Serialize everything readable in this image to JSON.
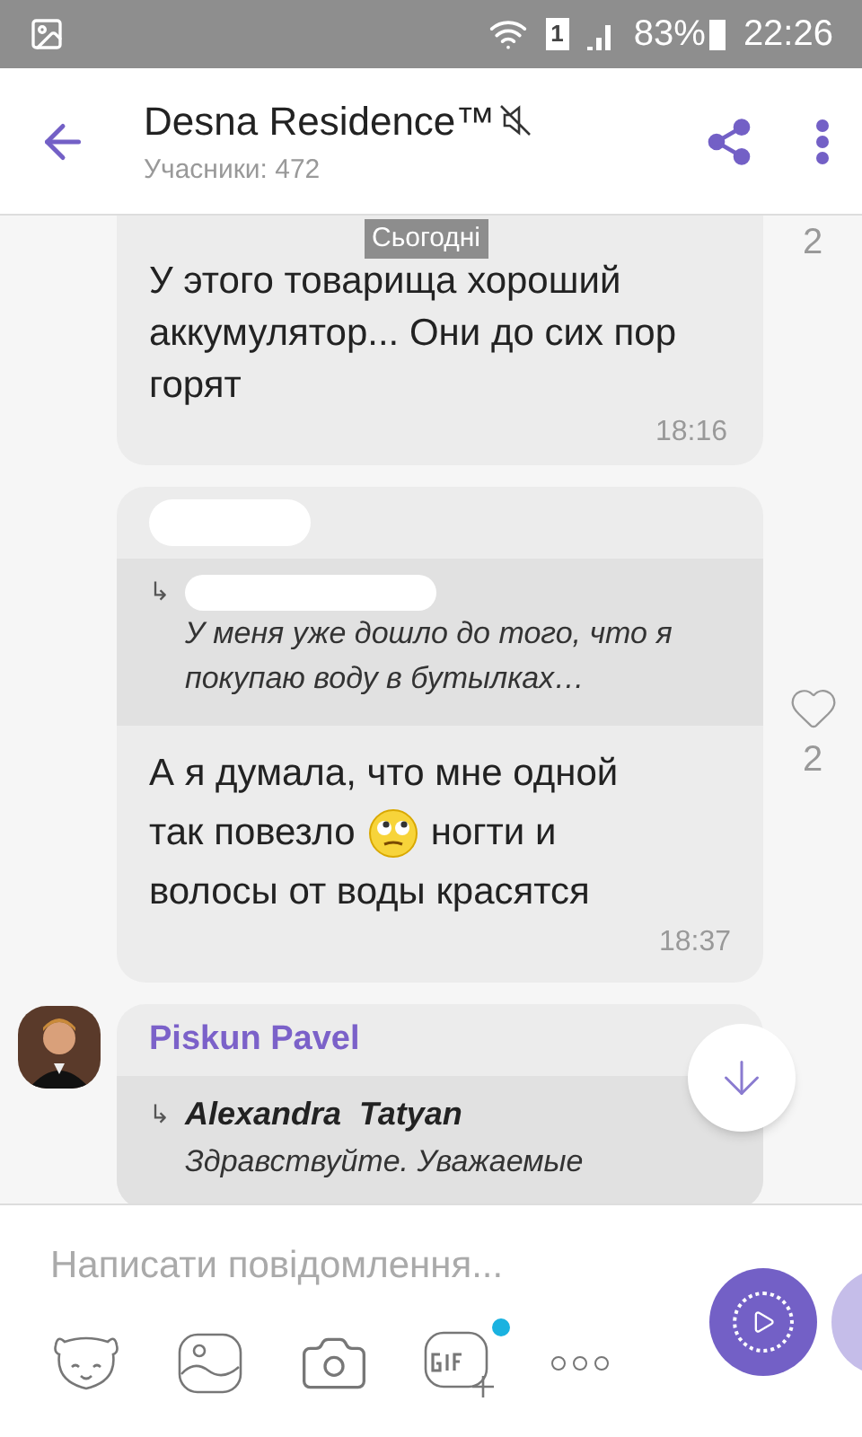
{
  "status_bar": {
    "sim": "1",
    "battery": "83%",
    "time": "22:26"
  },
  "header": {
    "title": "Desna Residence™",
    "muted": true,
    "subtitle": "Учасники: 472"
  },
  "date_badge": "Сьогодні",
  "messages": [
    {
      "kind": "plain",
      "text": "У этого товарища хороший аккумулятор... Они до сих пор горят",
      "time": "18:16",
      "likes": "2",
      "heart_visible": false
    },
    {
      "kind": "reply",
      "sender_redacted": true,
      "reply_mark": "↳",
      "quote_text": "У меня уже дошло до того, что я покупаю воду в бутылках…",
      "text_start": "А я думала, что мне одной",
      "text_mid_before": "так повезло",
      "text_mid_after": "ногти и",
      "text_end": "волосы от воды красятся",
      "emoji": true,
      "time": "18:37",
      "likes": "2",
      "heart_visible": true
    },
    {
      "kind": "reply",
      "sender": "Piskun Pavel",
      "avatar": true,
      "reply_mark": "↳",
      "quote_author": "Alexandra  Tatyan",
      "quote_text": "Здравствуйте. Уважаемые"
    }
  ],
  "composer": {
    "placeholder": "Написати повідомлення...",
    "gif_new": true
  }
}
